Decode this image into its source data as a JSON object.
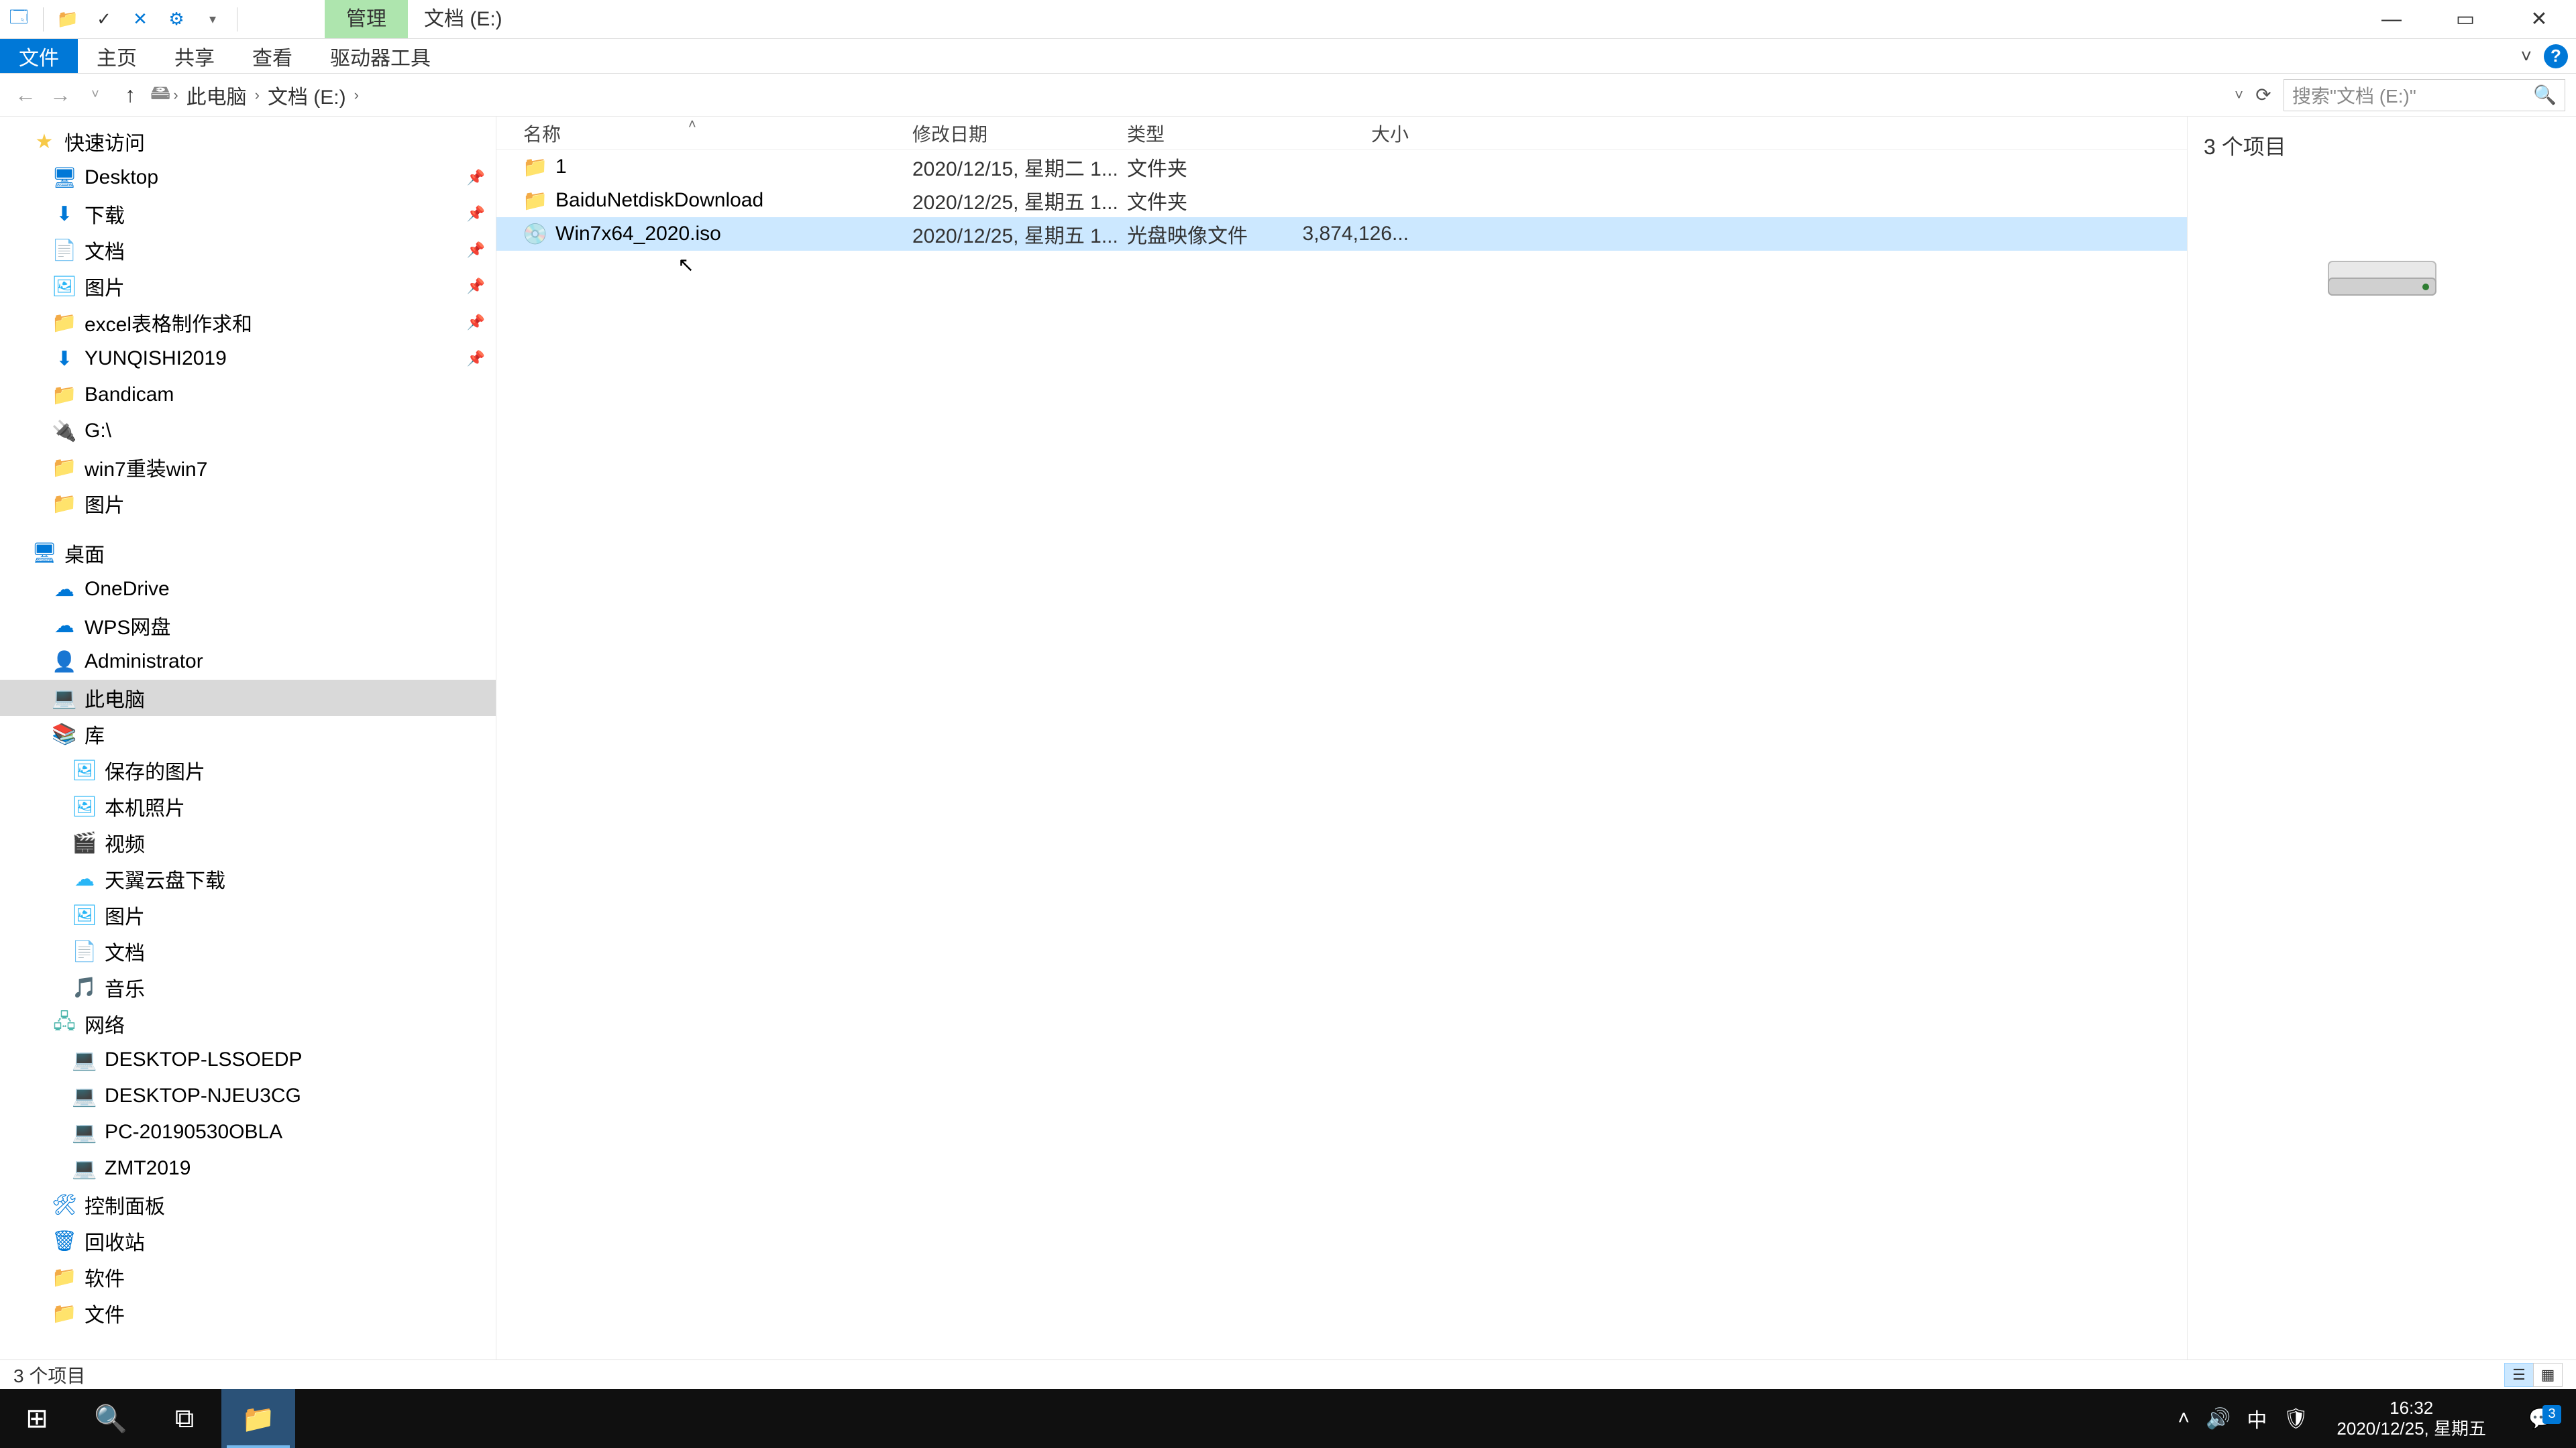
{
  "title": {
    "context_tab": "管理",
    "window_title": "文档 (E:)"
  },
  "window_controls": {
    "minimize": "—",
    "maximize": "▭",
    "close": "✕"
  },
  "ribbon": {
    "file": "文件",
    "home": "主页",
    "share": "共享",
    "view": "查看",
    "drive_tools": "驱动器工具"
  },
  "address": {
    "seg1": "此电脑",
    "seg2": "文档 (E:)"
  },
  "search": {
    "placeholder": "搜索\"文档 (E:)\""
  },
  "columns": {
    "name": "名称",
    "date": "修改日期",
    "type": "类型",
    "size": "大小"
  },
  "files": [
    {
      "icon": "📁",
      "name": "1",
      "date": "2020/12/15, 星期二 1...",
      "type": "文件夹",
      "size": ""
    },
    {
      "icon": "📁",
      "name": "BaiduNetdiskDownload",
      "date": "2020/12/25, 星期五 1...",
      "type": "文件夹",
      "size": ""
    },
    {
      "icon": "💿",
      "name": "Win7x64_2020.iso",
      "date": "2020/12/25, 星期五 1...",
      "type": "光盘映像文件",
      "size": "3,874,126...",
      "selected": true
    }
  ],
  "tree": {
    "quick_access": "快速访问",
    "desktop": "Desktop",
    "downloads": "下载",
    "documents": "文档",
    "pictures": "图片",
    "excel": "excel表格制作求和",
    "yunqishi": "YUNQISHI2019",
    "bandicam": "Bandicam",
    "gdrive": "G:\\",
    "win7reinstall": "win7重装win7",
    "pictures2": "图片",
    "desktop_root": "桌面",
    "onedrive": "OneDrive",
    "wps": "WPS网盘",
    "admin": "Administrator",
    "thispc": "此电脑",
    "libraries": "库",
    "saved_pics": "保存的图片",
    "camera_roll": "本机照片",
    "videos": "视频",
    "tianyi": "天翼云盘下载",
    "lib_pics": "图片",
    "lib_docs": "文档",
    "music": "音乐",
    "network": "网络",
    "pc1": "DESKTOP-LSSOEDP",
    "pc2": "DESKTOP-NJEU3CG",
    "pc3": "PC-20190530OBLA",
    "pc4": "ZMT2019",
    "control_panel": "控制面板",
    "recycle": "回收站",
    "software": "软件",
    "files_folder": "文件"
  },
  "preview": {
    "count": "3 个项目"
  },
  "status": {
    "text": "3 个项目"
  },
  "taskbar": {
    "time": "16:32",
    "date": "2020/12/25, 星期五",
    "ime": "中",
    "notif_count": "3"
  }
}
